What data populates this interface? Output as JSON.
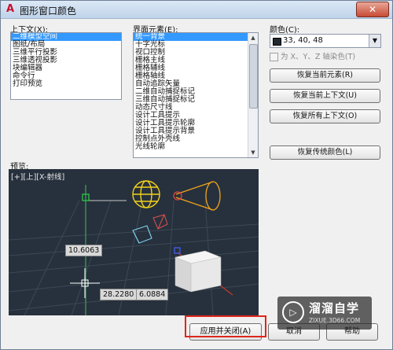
{
  "window": {
    "title": "图形窗口颜色",
    "close_label": "✕"
  },
  "context": {
    "label": "上下文(X):",
    "items": [
      "二维模型空间",
      "图纸/布局",
      "三维平行投影",
      "三维透视投影",
      "块编辑器",
      "命令行",
      "打印预览"
    ],
    "selected_index": 0
  },
  "interface": {
    "label": "界面元素(E):",
    "items": [
      "统一背景",
      "十字光标",
      "视口控制",
      "栅格主线",
      "栅格辅线",
      "栅格轴线",
      "自动追踪矢量",
      "二维自动捕捉标记",
      "三维自动捕捉标记",
      "动态尺寸线",
      "设计工具提示",
      "设计工具提示轮廓",
      "设计工具提示背景",
      "控制点外壳线",
      "光线轮廓"
    ],
    "selected_index": 0
  },
  "color": {
    "label": "颜色(C):",
    "value": "33, 40, 48",
    "swatch_hex": "#21282f",
    "tint_checkbox": "为 X、Y、Z 轴染色(T)"
  },
  "buttons": {
    "restore_element": "恢复当前元素(R)",
    "restore_context": "恢复当前上下文(U)",
    "restore_all": "恢复所有上下文(O)",
    "restore_classic": "恢复传统颜色(L)",
    "apply_close": "应用并关闭(A)",
    "cancel": "取消",
    "help": "帮助"
  },
  "preview": {
    "label": "预览:",
    "viewport_label": "[+][上][X-射线]",
    "measure_1": "10.6063",
    "measure_2": "28.2280",
    "measure_3": "6.0884",
    "background_hex": "#27313d"
  },
  "watermark": {
    "title": "溜溜自学",
    "subtitle": "ZIXUE.3D66.COM",
    "logo_glyph": "▷"
  },
  "colors": {
    "highlight": "#e1251b",
    "selection": "#3399ff"
  }
}
